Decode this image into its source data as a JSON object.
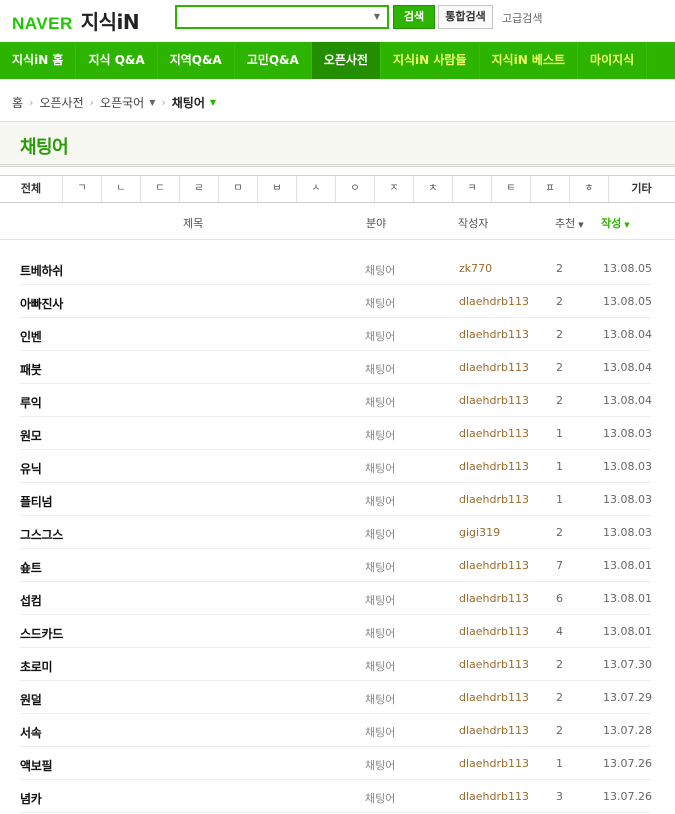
{
  "header": {
    "logo_naver": "NAVER",
    "logo_jisik": "지식iN",
    "search_value": "",
    "search_button": "검색",
    "total_search_button": "통합검색",
    "advanced_search_link": "고급검색"
  },
  "nav": {
    "items": [
      {
        "label": "지식iN 홈"
      },
      {
        "label": "지식 Q&A"
      },
      {
        "label": "지역Q&A"
      },
      {
        "label": "고민Q&A"
      },
      {
        "label": "오픈사전"
      },
      {
        "label": "지식iN 사람들"
      },
      {
        "label": "지식iN 베스트"
      },
      {
        "label": "마이지식"
      }
    ],
    "active_index": 4
  },
  "breadcrumb": {
    "home": "홈",
    "level1": "오픈사전",
    "level2": "오픈국어",
    "current": "채팅어"
  },
  "page_title": "채팅어",
  "index_bar": {
    "first": "전체",
    "letters": [
      "ㄱ",
      "ㄴ",
      "ㄷ",
      "ㄹ",
      "ㅁ",
      "ㅂ",
      "ㅅ",
      "ㅇ",
      "ㅈ",
      "ㅊ",
      "ㅋ",
      "ㅌ",
      "ㅍ",
      "ㅎ"
    ],
    "last": "기타"
  },
  "columns": {
    "title": "제목",
    "category": "분야",
    "author": "작성자",
    "recommend": "추천",
    "date": "작성"
  },
  "entries": [
    {
      "title": "트베하쉬",
      "category": "채팅어",
      "author": "zk770",
      "recommend": "2",
      "date": "13.08.05"
    },
    {
      "title": "아빠진사",
      "category": "채팅어",
      "author": "dlaehdrb113",
      "recommend": "2",
      "date": "13.08.05"
    },
    {
      "title": "인벤",
      "category": "채팅어",
      "author": "dlaehdrb113",
      "recommend": "2",
      "date": "13.08.04"
    },
    {
      "title": "패붓",
      "category": "채팅어",
      "author": "dlaehdrb113",
      "recommend": "2",
      "date": "13.08.04"
    },
    {
      "title": "루익",
      "category": "채팅어",
      "author": "dlaehdrb113",
      "recommend": "2",
      "date": "13.08.04"
    },
    {
      "title": "원모",
      "category": "채팅어",
      "author": "dlaehdrb113",
      "recommend": "1",
      "date": "13.08.03"
    },
    {
      "title": "유닉",
      "category": "채팅어",
      "author": "dlaehdrb113",
      "recommend": "1",
      "date": "13.08.03"
    },
    {
      "title": "플티넘",
      "category": "채팅어",
      "author": "dlaehdrb113",
      "recommend": "1",
      "date": "13.08.03"
    },
    {
      "title": "그스그스",
      "category": "채팅어",
      "author": "gigi319",
      "recommend": "2",
      "date": "13.08.03"
    },
    {
      "title": "숖트",
      "category": "채팅어",
      "author": "dlaehdrb113",
      "recommend": "7",
      "date": "13.08.01"
    },
    {
      "title": "섭컴",
      "category": "채팅어",
      "author": "dlaehdrb113",
      "recommend": "6",
      "date": "13.08.01"
    },
    {
      "title": "스드카드",
      "category": "채팅어",
      "author": "dlaehdrb113",
      "recommend": "4",
      "date": "13.08.01"
    },
    {
      "title": "초로미",
      "category": "채팅어",
      "author": "dlaehdrb113",
      "recommend": "2",
      "date": "13.07.30"
    },
    {
      "title": "원덜",
      "category": "채팅어",
      "author": "dlaehdrb113",
      "recommend": "2",
      "date": "13.07.29"
    },
    {
      "title": "서속",
      "category": "채팅어",
      "author": "dlaehdrb113",
      "recommend": "2",
      "date": "13.07.28"
    },
    {
      "title": "액보필",
      "category": "채팅어",
      "author": "dlaehdrb113",
      "recommend": "1",
      "date": "13.07.26"
    },
    {
      "title": "념카",
      "category": "채팅어",
      "author": "dlaehdrb113",
      "recommend": "3",
      "date": "13.07.26"
    }
  ],
  "colors": {
    "brand_green": "#2db400",
    "active_nav": "#238f00",
    "author_link": "#9a6a2a",
    "title_green": "#2a9a08"
  }
}
